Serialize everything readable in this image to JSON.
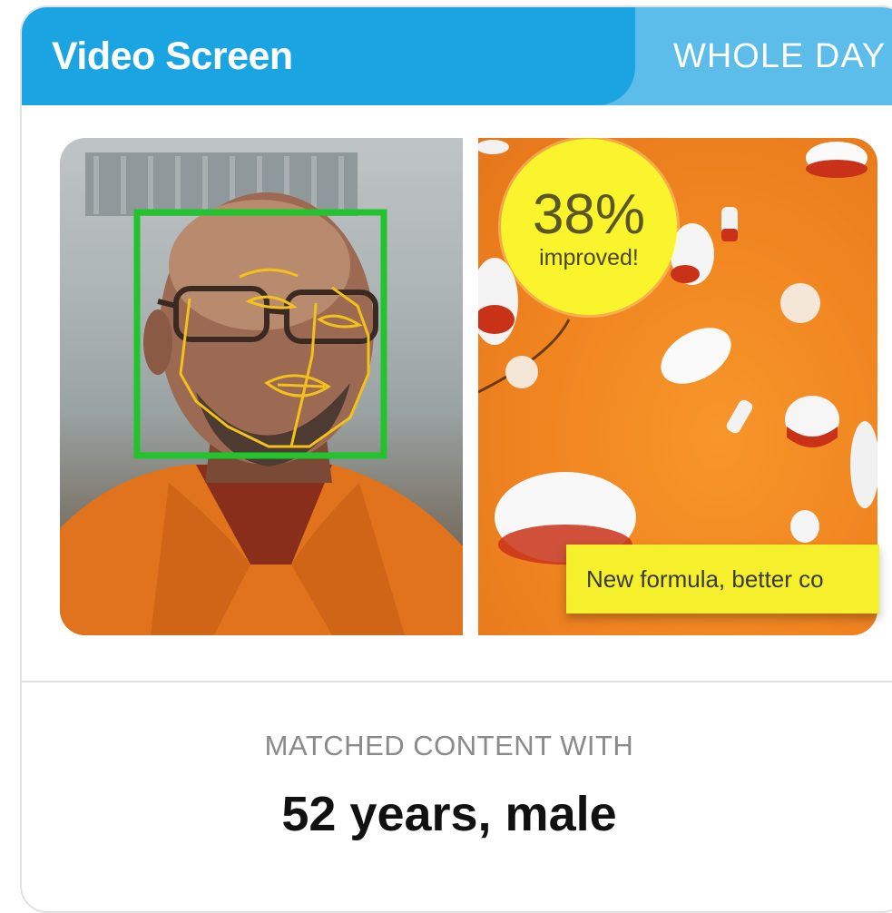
{
  "tabs": {
    "active_label": "Video Screen",
    "inactive_label": "WHOLE DAY"
  },
  "ad": {
    "badge_value": "38%",
    "badge_text": "improved!",
    "banner_text": "New formula, better co"
  },
  "result": {
    "label": "MATCHED CONTENT WITH",
    "value": "52 years, male"
  },
  "colors": {
    "tab_active": "#1aa4e2",
    "tab_inactive": "#5cbcea",
    "face_box": "#22c42e",
    "landmarks": "#f2c21a",
    "badge": "#f9f42b",
    "ad_background": "#f08420"
  },
  "icons": [
    "face-detection-box",
    "face-landmarks-overlay"
  ]
}
